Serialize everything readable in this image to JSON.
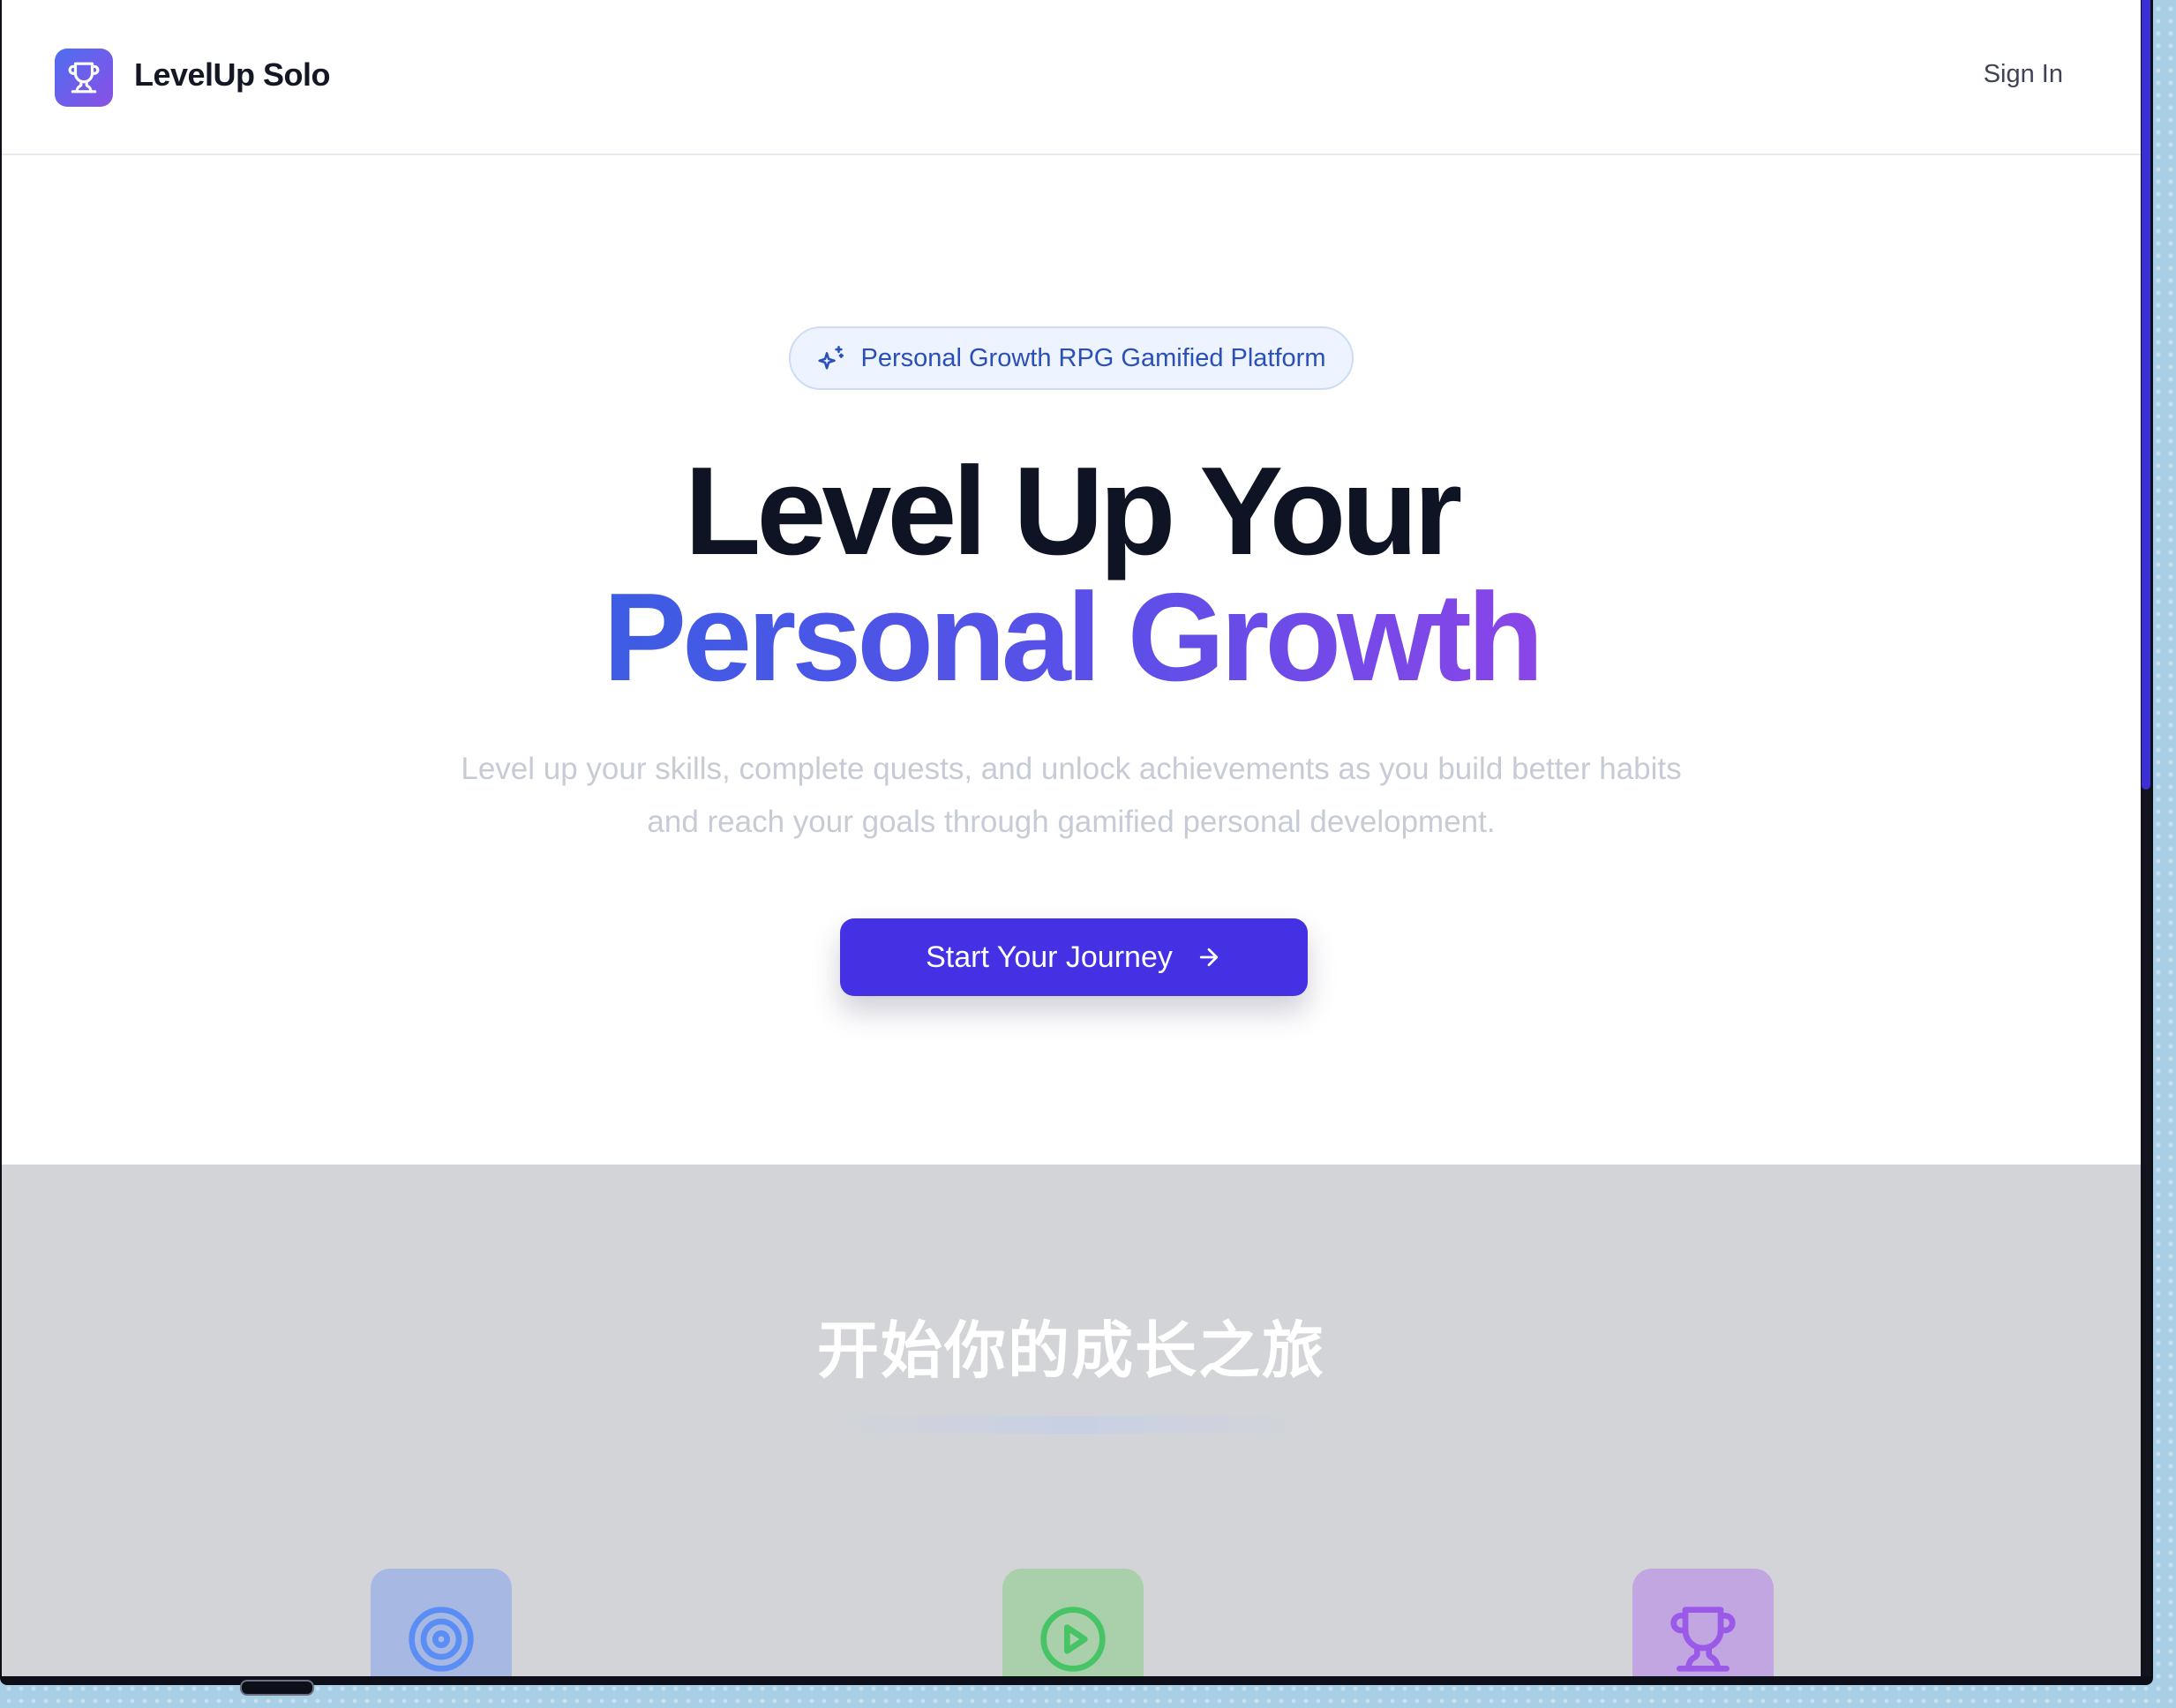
{
  "header": {
    "brand": "LevelUp Solo",
    "logo_icon": "trophy-icon",
    "sign_in": "Sign In"
  },
  "hero": {
    "badge_icon": "sparkles-icon",
    "badge": "Personal Growth RPG Gamified Platform",
    "title_line1": "Level Up Your",
    "title_line2": "Personal Growth",
    "subtitle": "Level up your skills, complete quests, and unlock achievements as you build better habits and reach your goals through gamified personal development.",
    "cta": "Start Your Journey",
    "cta_icon": "arrow-right-icon"
  },
  "section2": {
    "title": "开始你的成长之旅",
    "features": [
      {
        "icon": "target-icon",
        "color": "#5b8ef5"
      },
      {
        "icon": "play-circle-icon",
        "color": "#47c466"
      },
      {
        "icon": "trophy-icon",
        "color": "#9b59e8"
      }
    ]
  },
  "colors": {
    "primary": "#4431e3",
    "gradient_start": "#3d5ce4",
    "gradient_end": "#8a45e8",
    "section_bg": "#d3d4d8"
  }
}
